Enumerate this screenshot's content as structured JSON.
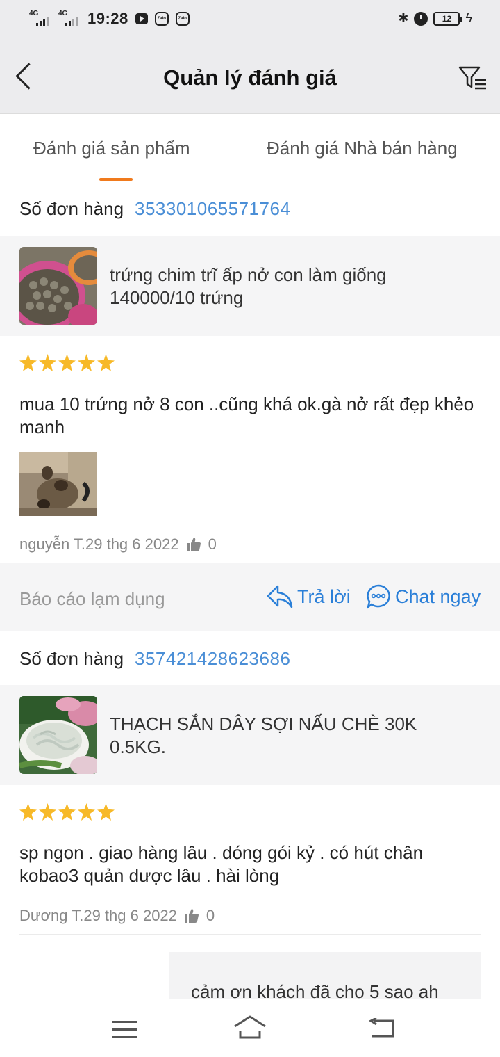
{
  "status_bar": {
    "network1": "4G",
    "network2": "4G",
    "time": "19:28",
    "battery": "12"
  },
  "header": {
    "title": "Quản lý đánh giá"
  },
  "tabs": [
    {
      "label": "Đánh giá sản phẩm",
      "active": true
    },
    {
      "label": "Đánh giá Nhà bán hàng",
      "active": false
    }
  ],
  "accent_color": "#f07a1d",
  "link_color": "#2a7fd8",
  "reviews": [
    {
      "order_label": "Số đơn hàng",
      "order_number": "353301065571764",
      "product_name": "trứng chim trĩ ấp nở con làm giống 140000/10 trứng",
      "rating": 5,
      "text": "mua 10 trứng nở 8 con ..cũng khá ok.gà nở rất đẹp khẻo manh",
      "meta": "nguyễn T.29 thg 6 2022",
      "likes": "0",
      "report_label": "Báo cáo lạm dụng",
      "reply_label": "Trả lời",
      "chat_label": "Chat ngay"
    },
    {
      "order_label": "Số đơn hàng",
      "order_number": "357421428623686",
      "product_name": "THẠCH SẮN DÂY SỢI NẤU CHÈ  30K 0.5KG.",
      "rating": 5,
      "text": "sp ngon . giao hàng lâu . dóng gói kỷ . có hút chân kobao3 quản dược lâu . hài lòng",
      "meta": "Dương T.29 thg 6 2022",
      "likes": "0",
      "seller_reply": "cảm ơn khách đã cho 5 sao ah"
    }
  ]
}
